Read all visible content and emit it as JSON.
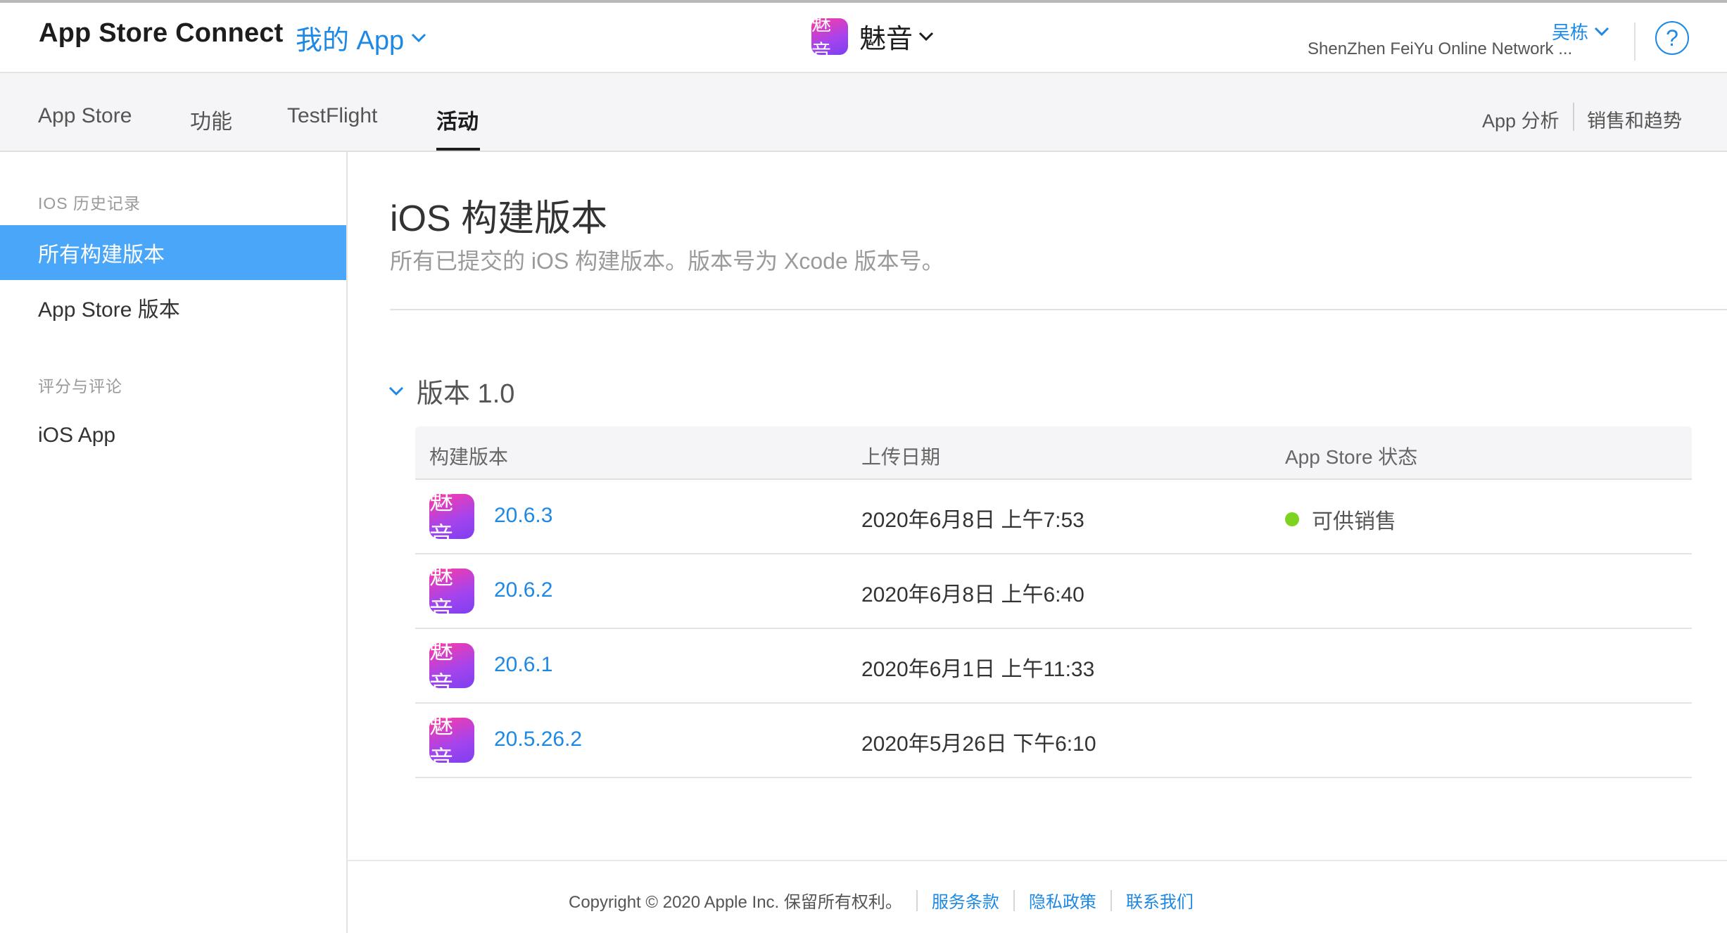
{
  "header": {
    "brand": "App Store Connect",
    "my_apps": "我的 App",
    "app_icon_text": "魅音",
    "app_name": "魅音",
    "user_name": "吴栋",
    "org_name": "ShenZhen FeiYu Online Network ...",
    "help": "?"
  },
  "nav": {
    "tabs": [
      {
        "label": "App Store"
      },
      {
        "label": "功能"
      },
      {
        "label": "TestFlight"
      },
      {
        "label": "活动",
        "active": true
      }
    ],
    "right": [
      "App 分析",
      "销售和趋势"
    ]
  },
  "sidebar": {
    "section1": "IOS 历史记录",
    "items1": [
      "所有构建版本",
      "App Store 版本"
    ],
    "section2": "评分与评论",
    "items2": [
      "iOS App"
    ]
  },
  "main": {
    "title": "iOS 构建版本",
    "subtitle": "所有已提交的 iOS 构建版本。版本号为 Xcode 版本号。",
    "version_label": "版本 1.0",
    "columns": [
      "构建版本",
      "上传日期",
      "App Store 状态"
    ],
    "rows": [
      {
        "icon": "魅音",
        "build": "20.6.3",
        "date": "2020年6月8日 上午7:53",
        "status": "可供销售"
      },
      {
        "icon": "魅音",
        "build": "20.6.2",
        "date": "2020年6月8日 上午6:40",
        "status": ""
      },
      {
        "icon": "魅音",
        "build": "20.6.1",
        "date": "2020年6月1日 上午11:33",
        "status": ""
      },
      {
        "icon": "魅音",
        "build": "20.5.26.2",
        "date": "2020年5月26日 下午6:10",
        "status": ""
      }
    ],
    "status_color": "#7ed321"
  },
  "footer": {
    "copyright": "Copyright © 2020 Apple Inc. 保留所有权利。",
    "links": [
      "服务条款",
      "隐私政策",
      "联系我们"
    ]
  },
  "colors": {
    "accent": "#1e88e5",
    "sidebar_active": "#4aa6f8"
  }
}
